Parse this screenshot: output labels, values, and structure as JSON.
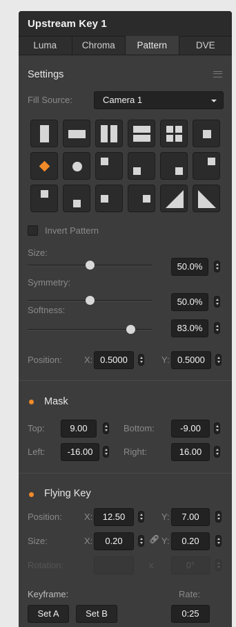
{
  "header": {
    "title": "Upstream Key 1"
  },
  "tabs": [
    {
      "label": "Luma",
      "active": false
    },
    {
      "label": "Chroma",
      "active": false
    },
    {
      "label": "Pattern",
      "active": true
    },
    {
      "label": "DVE",
      "active": false
    }
  ],
  "settings": {
    "title": "Settings",
    "fill_source_label": "Fill Source:",
    "fill_source_value": "Camera 1",
    "pattern_icons": [
      "vertical-bar-icon",
      "horizontal-bar-icon",
      "vertical-barn-door-icon",
      "horizontal-barn-door-icon",
      "corners-box-icon",
      "center-box-icon",
      "diamond-iris-icon",
      "circle-iris-icon",
      "top-left-box-icon",
      "bottom-left-box-icon",
      "bottom-right-box-icon",
      "top-right-box-icon",
      "top-center-box-icon",
      "bottom-center-box-icon",
      "left-center-box-icon",
      "right-center-box-icon",
      "top-left-diagonal-icon",
      "top-right-diagonal-icon"
    ],
    "selected_pattern": "diamond-iris-icon",
    "invert_pattern_label": "Invert Pattern",
    "invert_pattern_checked": false,
    "size_label": "Size:",
    "size_value": "50.0%",
    "size_level": 0.5,
    "symmetry_label": "Symmetry:",
    "symmetry_value": "50.0%",
    "symmetry_level": 0.5,
    "softness_label": "Softness:",
    "softness_value": "83.0%",
    "softness_level": 0.83,
    "position_label": "Position:",
    "x_label": "X:",
    "y_label": "Y:",
    "position_x": "0.5000",
    "position_y": "0.5000"
  },
  "mask": {
    "title": "Mask",
    "enabled": true,
    "top_label": "Top:",
    "top_value": "9.00",
    "bottom_label": "Bottom:",
    "bottom_value": "-9.00",
    "left_label": "Left:",
    "left_value": "-16.00",
    "right_label": "Right:",
    "right_value": "16.00"
  },
  "flying_key": {
    "title": "Flying Key",
    "enabled": true,
    "position_label": "Position:",
    "size_label": "Size:",
    "rotation_label": "Rotation:",
    "x_label": "X:",
    "y_label": "Y:",
    "position_x": "12.50",
    "position_y": "7.00",
    "size_x": "0.20",
    "size_y": "0.20",
    "rotation_x_label": "x",
    "rotation_value": "0°",
    "keyframe_label": "Keyframe:",
    "rate_label": "Rate:",
    "set_a_label": "Set A",
    "set_b_label": "Set B",
    "rate_value": "0:25"
  },
  "colors": {
    "accent": "#f28a2a",
    "panel": "#3c3c3c",
    "field": "#222222"
  }
}
